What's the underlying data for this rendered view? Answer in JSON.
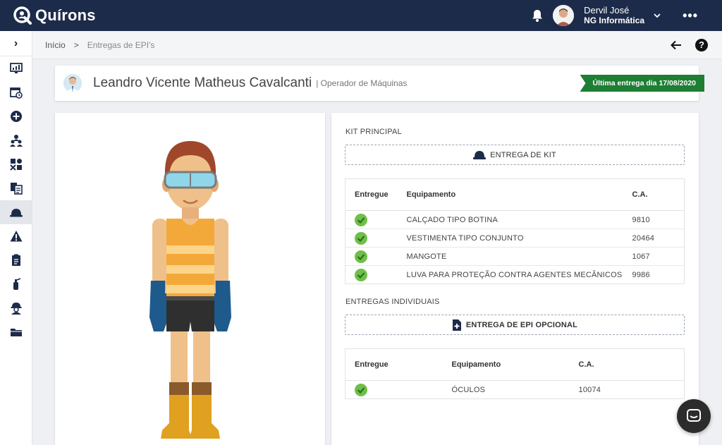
{
  "app": {
    "name": "Quírons"
  },
  "user": {
    "name": "Dervil José",
    "company": "NG Informática"
  },
  "breadcrumb": {
    "home": "Início",
    "separator": ">",
    "current": "Entregas de EPI's"
  },
  "employee": {
    "name": "Leandro Vicente Matheus Cavalcanti",
    "role": "| Operador de Máquinas",
    "last_delivery": "Última entrega dia 17/08/2020"
  },
  "kit": {
    "title": "KIT PRINCIPAL",
    "button_label": "ENTREGA DE KIT",
    "columns": {
      "delivered": "Entregue",
      "equipment": "Equipamento",
      "ca": "C.A."
    },
    "rows": [
      {
        "equipment": "CALÇADO TIPO BOTINA",
        "ca": "9810",
        "delivered": true
      },
      {
        "equipment": "VESTIMENTA TIPO CONJUNTO",
        "ca": "20464",
        "delivered": true
      },
      {
        "equipment": "MANGOTE",
        "ca": "1067",
        "delivered": true
      },
      {
        "equipment": "LUVA PARA PROTEÇÃO CONTRA AGENTES MECÂNICOS",
        "ca": "9986",
        "delivered": true
      }
    ]
  },
  "individual": {
    "title": "ENTREGAS INDIVIDUAIS",
    "button_label": "ENTREGA DE EPI OPCIONAL",
    "columns": {
      "delivered": "Entregue",
      "equipment": "Equipamento",
      "ca": "C.A."
    },
    "rows": [
      {
        "equipment": "ÓCULOS",
        "ca": "10074",
        "delivered": true
      }
    ]
  },
  "colors": {
    "topbar": "#1d2b4a",
    "ribbon": "#1e7e34",
    "check": "#6fbf4a",
    "ca": "#d35400"
  },
  "icons": {
    "sidebar": [
      "monitor-icon",
      "calendar-clock-icon",
      "plus-circle-icon",
      "users-icon",
      "puzzle-icon",
      "documents-icon",
      "helmet-icon",
      "warning-icon",
      "clipboard-icon",
      "fire-extinguisher-icon",
      "worker-icon",
      "folder-icon"
    ]
  }
}
